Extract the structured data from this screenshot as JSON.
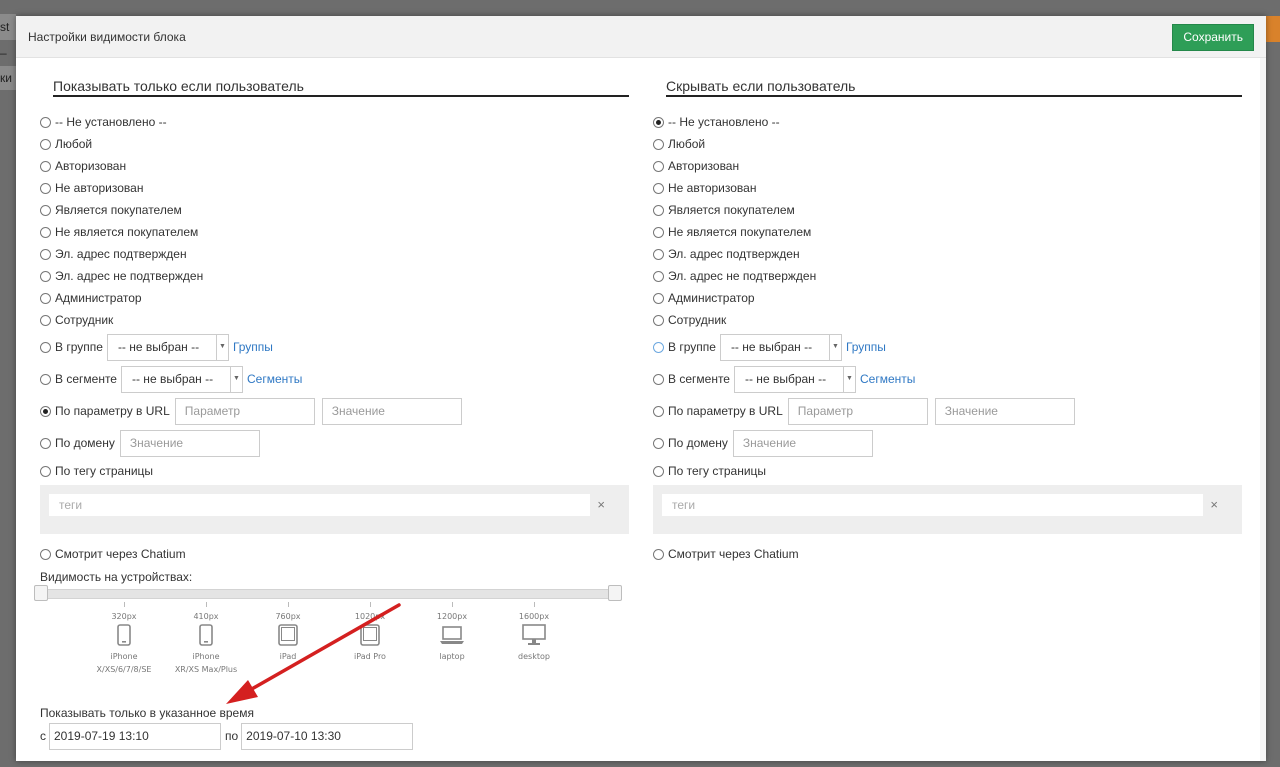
{
  "background": {
    "frag_top": "st –",
    "frag_mid": "ки"
  },
  "header": {
    "title": "Настройки видимости блока",
    "save_label": "Сохранить"
  },
  "left": {
    "title": "Показывать только если пользователь",
    "options": [
      "-- Не установлено --",
      "Любой",
      "Авторизован",
      "Не авторизован",
      "Является покупателем",
      "Не является покупателем",
      "Эл. адрес подтвержден",
      "Эл. адрес не подтвержден",
      "Администратор",
      "Сотрудник"
    ],
    "group_label": "В группе",
    "group_select": "-- не выбран --",
    "group_link": "Группы",
    "segment_label": "В сегменте",
    "segment_select": "-- не выбран --",
    "segment_link": "Сегменты",
    "url_param_label": "По параметру в URL",
    "url_param_placeholder": "Параметр",
    "url_value_placeholder": "Значение",
    "domain_label": "По домену",
    "domain_placeholder": "Значение",
    "tag_label": "По тегу страницы",
    "tags_placeholder": "теги",
    "tags_clear": "×",
    "chatium_label": "Смотрит через Chatium",
    "selected": "url_param"
  },
  "right": {
    "title": "Скрывать если пользователь",
    "options": [
      "-- Не установлено --",
      "Любой",
      "Авторизован",
      "Не авторизован",
      "Является покупателем",
      "Не является покупателем",
      "Эл. адрес подтвержден",
      "Эл. адрес не подтвержден",
      "Администратор",
      "Сотрудник"
    ],
    "group_label": "В группе",
    "group_select": "-- не выбран --",
    "group_link": "Группы",
    "segment_label": "В сегменте",
    "segment_select": "-- не выбран --",
    "segment_link": "Сегменты",
    "url_param_label": "По параметру в URL",
    "url_param_placeholder": "Параметр",
    "url_value_placeholder": "Значение",
    "domain_label": "По домену",
    "domain_placeholder": "Значение",
    "tag_label": "По тегу страницы",
    "tags_placeholder": "теги",
    "tags_clear": "×",
    "chatium_label": "Смотрит через Chatium",
    "selected": "not_set"
  },
  "devices": {
    "label": "Видимость на устройствах:",
    "items": [
      {
        "px": "320px",
        "name1": "iPhone",
        "name2": "X/XS/6/7/8/SE",
        "icon": "phone-icon"
      },
      {
        "px": "410px",
        "name1": "iPhone",
        "name2": "XR/XS Max/Plus",
        "icon": "phone-icon"
      },
      {
        "px": "760px",
        "name1": "iPad",
        "name2": "",
        "icon": "tablet-icon"
      },
      {
        "px": "1020px",
        "name1": "iPad Pro",
        "name2": "",
        "icon": "tablet-icon"
      },
      {
        "px": "1200px",
        "name1": "laptop",
        "name2": "",
        "icon": "laptop-icon"
      },
      {
        "px": "1600px",
        "name1": "desktop",
        "name2": "",
        "icon": "desktop-icon"
      }
    ]
  },
  "time": {
    "label": "Показывать только в указанное время",
    "from_label": "с",
    "from_value": "2019-07-19 13:10",
    "to_label": "по",
    "to_value": "2019-07-10 13:30"
  },
  "colors": {
    "save": "#2e9e57",
    "link": "#2f78c4",
    "annotation_arrow": "#d42020"
  }
}
